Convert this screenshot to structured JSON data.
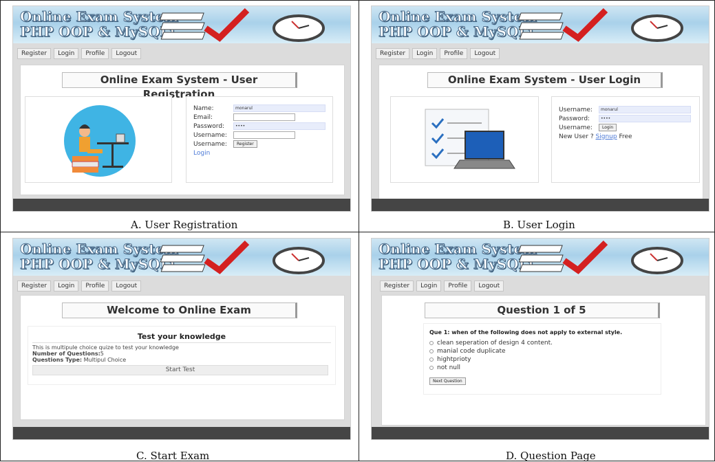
{
  "banner": {
    "line1": "Online Exam System",
    "line2": "PHP OOP & MySQLi"
  },
  "nav": {
    "register": "Register",
    "login": "Login",
    "profile": "Profile",
    "logout": "Logout"
  },
  "registration": {
    "title": "Online Exam System - User Registration",
    "fields": {
      "name_label": "Name:",
      "name_value": "monarul",
      "email_label": "Email:",
      "password_label": "Password:",
      "password_value": "••••",
      "username_label": "Username:",
      "username2_label": "Username:",
      "register_button": "Register",
      "login_link": "Login"
    },
    "caption": "A.   User Registration"
  },
  "login": {
    "title": "Online Exam System - User Login",
    "fields": {
      "username_label": "Username:",
      "username_value": "monarul",
      "password_label": "Password:",
      "password_value": "••••",
      "username2_label": "Username:",
      "login_button": "Login",
      "new_user": "New User ?",
      "signup_link": "Signup",
      "free": "Free"
    },
    "caption": "B.   User Login"
  },
  "start": {
    "title": "Welcome to Online Exam",
    "card_title": "Test your knowledge",
    "description": "This is multipule choice quize to test your knowledge",
    "num_label": "Number of Questions:",
    "num_value": "5",
    "type_label": "Questions Type:",
    "type_value": "Multipul Choice",
    "start_button": "Start Test",
    "caption": "C.   Start Exam"
  },
  "question": {
    "title": "Question 1 of 5",
    "text": "Que 1: when of the following does not apply to external style.",
    "options": [
      "clean seperation of design 4 content.",
      "manial code duplicate",
      "hightprioty",
      "not null"
    ],
    "next_button": "Next Question",
    "caption": "D.   Question Page"
  },
  "colors": {
    "banner": "#a9d1ea",
    "footer": "#454545",
    "link": "#4a78d6",
    "check": "#d42020"
  }
}
